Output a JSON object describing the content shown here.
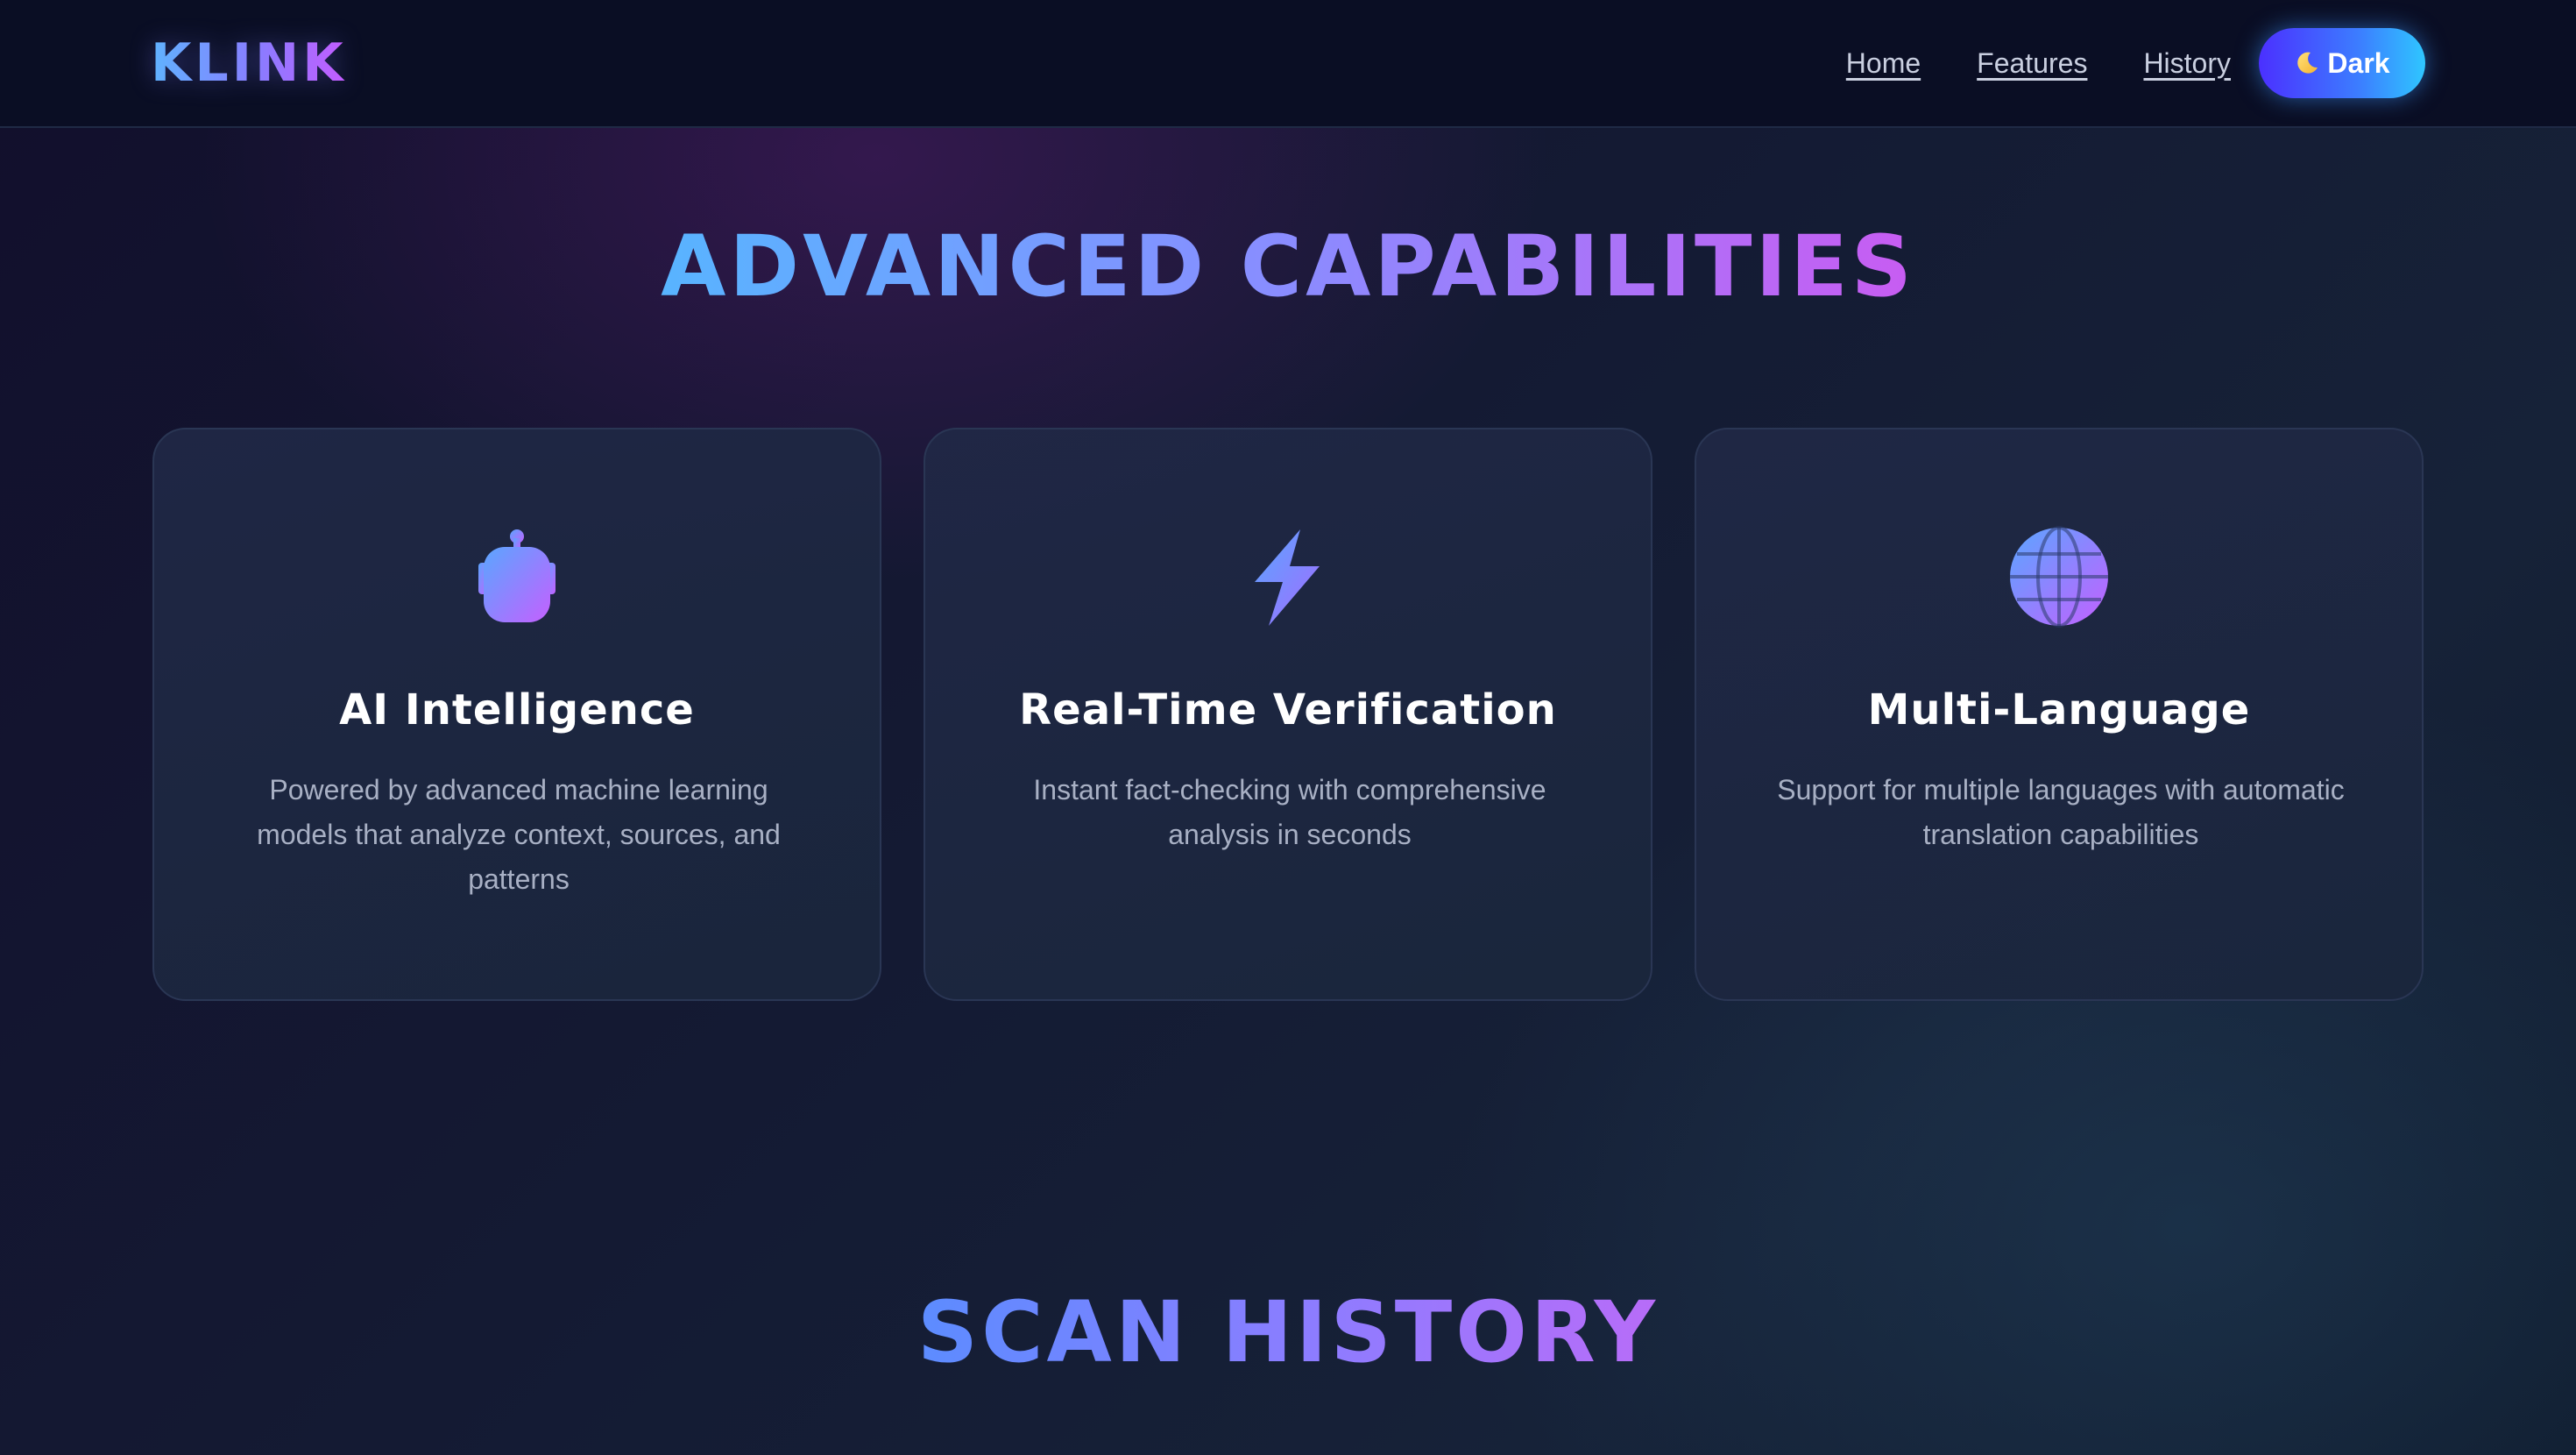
{
  "header": {
    "brand": "KLINK",
    "nav": {
      "home": "Home",
      "features": "Features",
      "history": "History"
    },
    "theme_toggle": {
      "icon": "moon-icon",
      "label": "Dark"
    }
  },
  "capabilities": {
    "title": "ADVANCED CAPABILITIES",
    "cards": [
      {
        "icon": "robot-icon",
        "title": "AI Intelligence",
        "description": "Powered by advanced machine learning models that analyze context, sources, and patterns"
      },
      {
        "icon": "lightning-icon",
        "title": "Real-Time Verification",
        "description": "Instant fact-checking with comprehensive analysis in seconds"
      },
      {
        "icon": "globe-icon",
        "title": "Multi-Language",
        "description": "Support for multiple languages with automatic translation capabilities"
      }
    ]
  },
  "history": {
    "title": "SCAN HISTORY"
  },
  "colors": {
    "accent_blue": "#58b4ff",
    "accent_purple": "#c85cf2",
    "toggle_gradient_start": "#4b30ff",
    "toggle_gradient_end": "#2fc6ff",
    "header_bg": "#0a0e24"
  }
}
